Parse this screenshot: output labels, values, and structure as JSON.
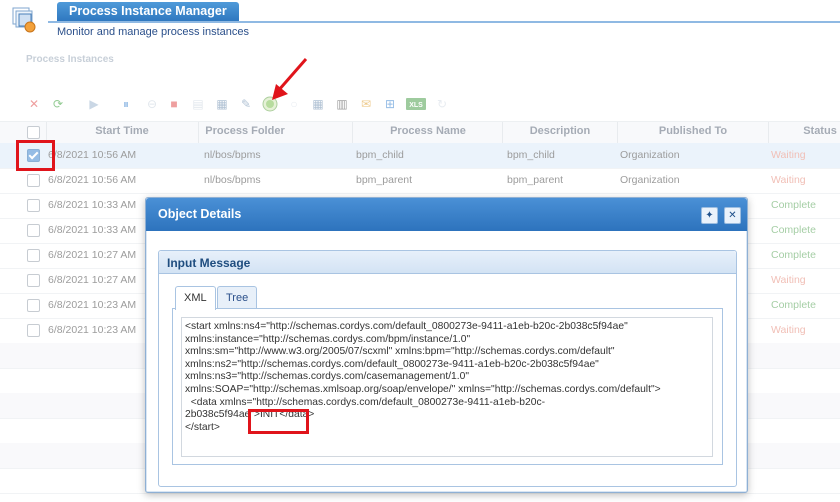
{
  "header": {
    "title": "Process Instance Manager",
    "subtitle": "Monitor and manage process instances"
  },
  "section": {
    "title": "Process Instances"
  },
  "toolbar": {
    "icons": [
      "delete-icon",
      "refresh-icon",
      "play-icon",
      "pause-icon",
      "stop-icon",
      "terminate-icon",
      "details-icon",
      "edit-icon",
      "view-message-icon",
      "circle-icon",
      "table-icon",
      "barcode-icon",
      "mail-icon",
      "hierarchy-icon",
      "excel-icon",
      "reload-icon"
    ]
  },
  "grid": {
    "columns": [
      "Start Time",
      "Process Folder",
      "Process Name",
      "Description",
      "Published To",
      "Status"
    ],
    "rows": [
      {
        "start": "6/8/2021 10:56 AM",
        "folder": "nl/bos/bpms",
        "name": "bpm_child",
        "description": "bpm_child",
        "published": "Organization",
        "status": "Waiting",
        "selected": true
      },
      {
        "start": "6/8/2021 10:56 AM",
        "folder": "nl/bos/bpms",
        "name": "bpm_parent",
        "description": "bpm_parent",
        "published": "Organization",
        "status": "Waiting",
        "selected": false
      },
      {
        "start": "6/8/2021 10:33 AM",
        "folder": "",
        "name": "",
        "description": "",
        "published": "",
        "status": "Complete",
        "selected": false
      },
      {
        "start": "6/8/2021 10:33 AM",
        "folder": "",
        "name": "",
        "description": "",
        "published": "",
        "status": "Complete",
        "selected": false
      },
      {
        "start": "6/8/2021 10:27 AM",
        "folder": "",
        "name": "",
        "description": "",
        "published": "",
        "status": "Complete",
        "selected": false
      },
      {
        "start": "6/8/2021 10:27 AM",
        "folder": "",
        "name": "",
        "description": "",
        "published": "",
        "status": "Waiting",
        "selected": false
      },
      {
        "start": "6/8/2021 10:23 AM",
        "folder": "",
        "name": "",
        "description": "",
        "published": "",
        "status": "Complete",
        "selected": false
      },
      {
        "start": "6/8/2021 10:23 AM",
        "folder": "",
        "name": "",
        "description": "",
        "published": "",
        "status": "Waiting",
        "selected": false
      }
    ]
  },
  "modal": {
    "title": "Object Details",
    "panel_title": "Input Message",
    "tabs": [
      "XML",
      "Tree"
    ],
    "active_tab": "XML",
    "xml_lines": [
      "<start xmlns:ns4=\"http://schemas.cordys.com/default_0800273e-9411-a1eb-b20c-2b038c5f94ae\"",
      "xmlns:instance=\"http://schemas.cordys.com/bpm/instance/1.0\"",
      "xmlns:sm=\"http://www.w3.org/2005/07/scxml\" xmlns:bpm=\"http://schemas.cordys.com/default\"",
      "xmlns:ns2=\"http://schemas.cordys.com/default_0800273e-9411-a1eb-b20c-2b038c5f94ae\"",
      "xmlns:ns3=\"http://schemas.cordys.com/casemanagement/1.0\"",
      "xmlns:SOAP=\"http://schemas.xmlsoap.org/soap/envelope/\" xmlns=\"http://schemas.cordys.com/default\">",
      "  <data xmlns=\"http://schemas.cordys.com/default_0800273e-9411-a1eb-b20c-",
      "2b038c5f94ae\">INIT</data>",
      "</start>"
    ]
  },
  "colors": {
    "accent": "#2f78c0",
    "annotation": "#e0141b",
    "waiting": "#e58a7a",
    "complete": "#5aa55a"
  }
}
